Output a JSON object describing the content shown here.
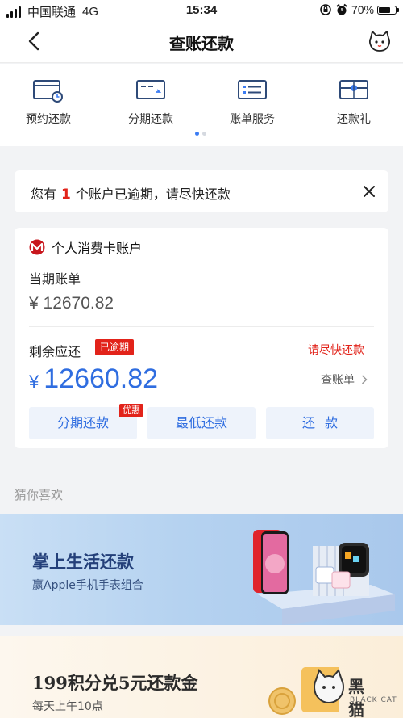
{
  "status_bar": {
    "carrier": "中国联通",
    "network": "4G",
    "time": "15:34",
    "battery": "70%",
    "battery_level": 0.7
  },
  "nav": {
    "title": "查账还款",
    "back_icon": "chevron-left-icon",
    "cat_icon": "cat-icon"
  },
  "quick_actions": [
    {
      "label": "预约还款",
      "icon": "scheduled-repay-icon"
    },
    {
      "label": "分期还款",
      "icon": "installment-icon"
    },
    {
      "label": "账单服务",
      "icon": "bill-service-icon"
    },
    {
      "label": "还款礼",
      "icon": "repay-gift-icon"
    }
  ],
  "notice": {
    "prefix": "您有",
    "count": "1",
    "suffix": "个账户已逾期，请尽快还款"
  },
  "account": {
    "title": "个人消费卡账户",
    "period_label": "当期账单",
    "period_amount": "¥ 12670.82",
    "remaining_label": "剩余应还",
    "overdue_badge": "已逾期",
    "urge_text": "请尽快还款",
    "currency": "¥",
    "remaining_amount": "12660.82",
    "view_bill": "查账单",
    "buttons": {
      "installment": "分期还款",
      "installment_tag": "优惠",
      "minimum": "最低还款",
      "repay": "还款"
    }
  },
  "guess_title": "猜你喜欢",
  "banner1": {
    "title": "掌上生活还款",
    "subtitle": "赢Apple手机手表组合"
  },
  "banner2": {
    "title": "199积分兑5元还款金",
    "subtitle": "每天上午10点"
  },
  "watermark": {
    "text": "黑猫",
    "sub": "BLACK CAT"
  },
  "colors": {
    "accent_blue": "#2f6de0",
    "alert_red": "#e2231a",
    "bank_red": "#c8161d"
  }
}
